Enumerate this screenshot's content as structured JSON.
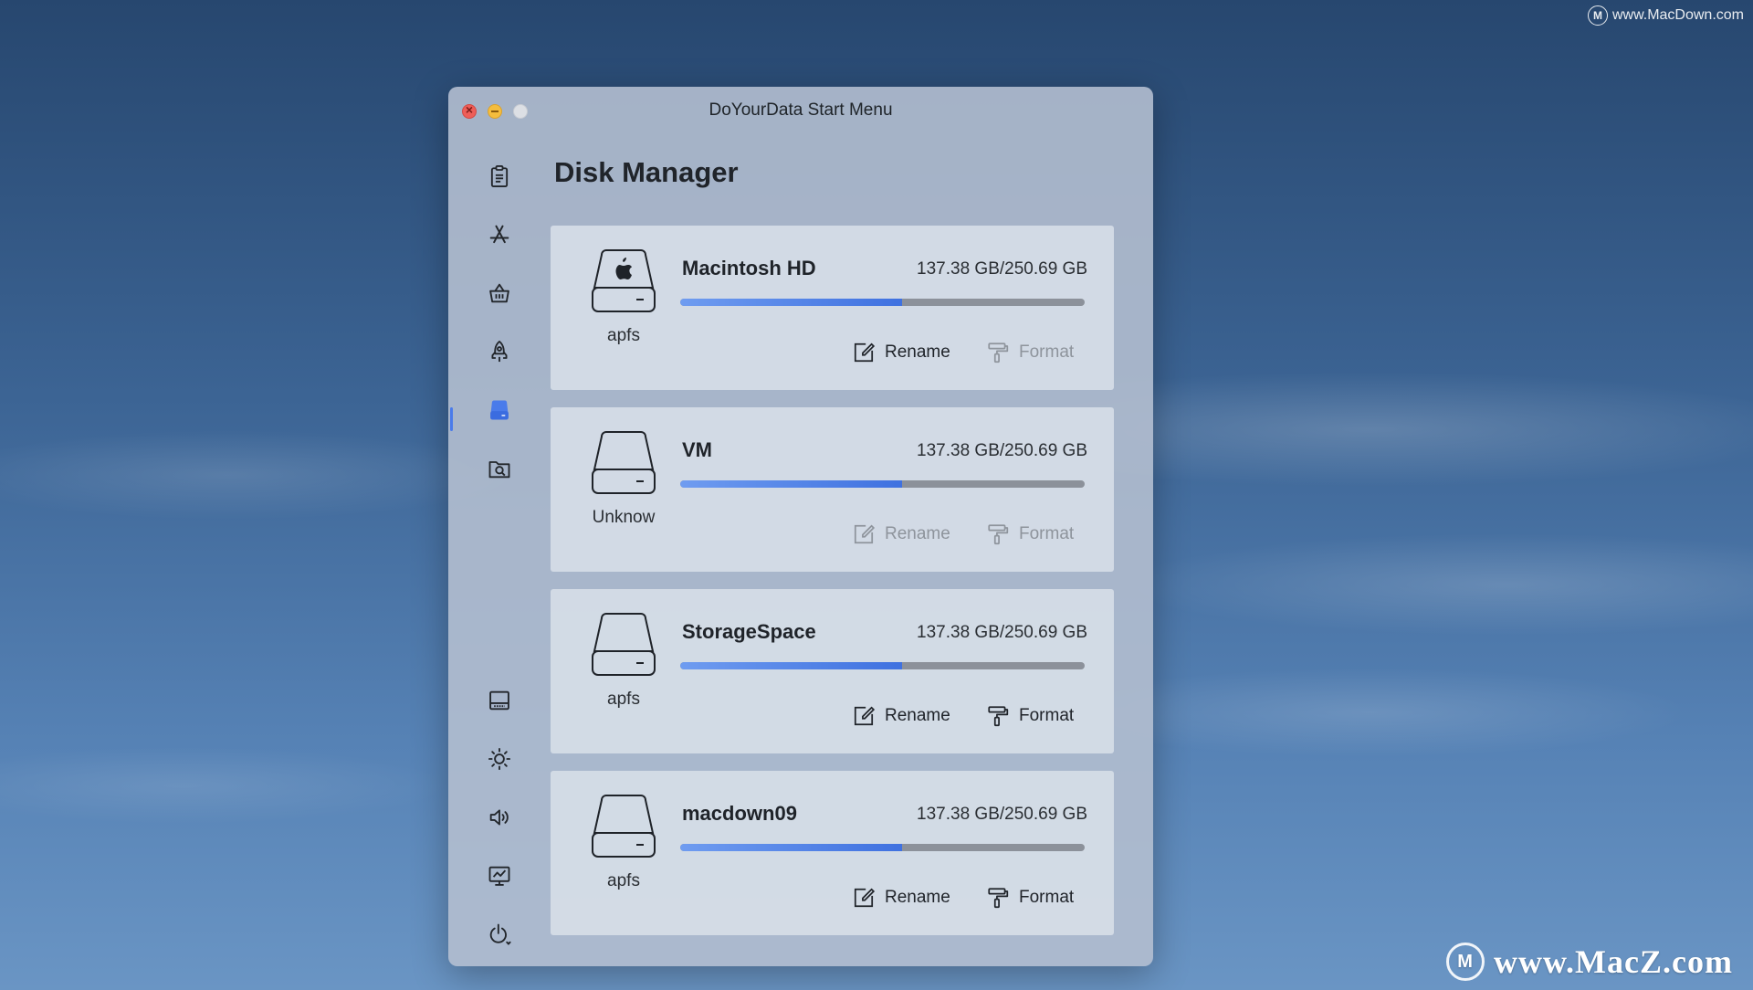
{
  "watermarks": {
    "top": "www.MacDown.com",
    "bottom": "www.MacZ.com",
    "logo_letter": "M"
  },
  "window": {
    "title": "DoYourData Start Menu"
  },
  "sidebar": {
    "items": [
      {
        "icon": "clipboard-icon"
      },
      {
        "icon": "app-store-icon"
      },
      {
        "icon": "basket-icon"
      },
      {
        "icon": "rocket-icon"
      },
      {
        "icon": "disk-icon",
        "active": true
      },
      {
        "icon": "folder-search-icon"
      },
      {
        "icon": "screen-icon"
      },
      {
        "icon": "brightness-icon"
      },
      {
        "icon": "volume-icon"
      },
      {
        "icon": "display-icon"
      },
      {
        "icon": "power-icon"
      }
    ]
  },
  "main": {
    "title": "Disk Manager",
    "rename_label": "Rename",
    "format_label": "Format",
    "disks": [
      {
        "name": "Macintosh HD",
        "filesystem": "apfs",
        "size": "137.38 GB/250.69 GB",
        "usage_fraction": 0.548,
        "system_disk": true,
        "rename_enabled": true,
        "format_enabled": false
      },
      {
        "name": "VM",
        "filesystem": "Unknow",
        "size": "137.38 GB/250.69 GB",
        "usage_fraction": 0.548,
        "system_disk": false,
        "rename_enabled": false,
        "format_enabled": false
      },
      {
        "name": "StorageSpace",
        "filesystem": "apfs",
        "size": "137.38 GB/250.69 GB",
        "usage_fraction": 0.548,
        "system_disk": false,
        "rename_enabled": true,
        "format_enabled": true
      },
      {
        "name": "macdown09",
        "filesystem": "apfs",
        "size": "137.38 GB/250.69 GB",
        "usage_fraction": 0.548,
        "system_disk": false,
        "rename_enabled": true,
        "format_enabled": true
      }
    ]
  },
  "colors": {
    "accent": "#4a7bea",
    "bar_track": "#8c919a",
    "disabled_text": "#8e949c"
  }
}
